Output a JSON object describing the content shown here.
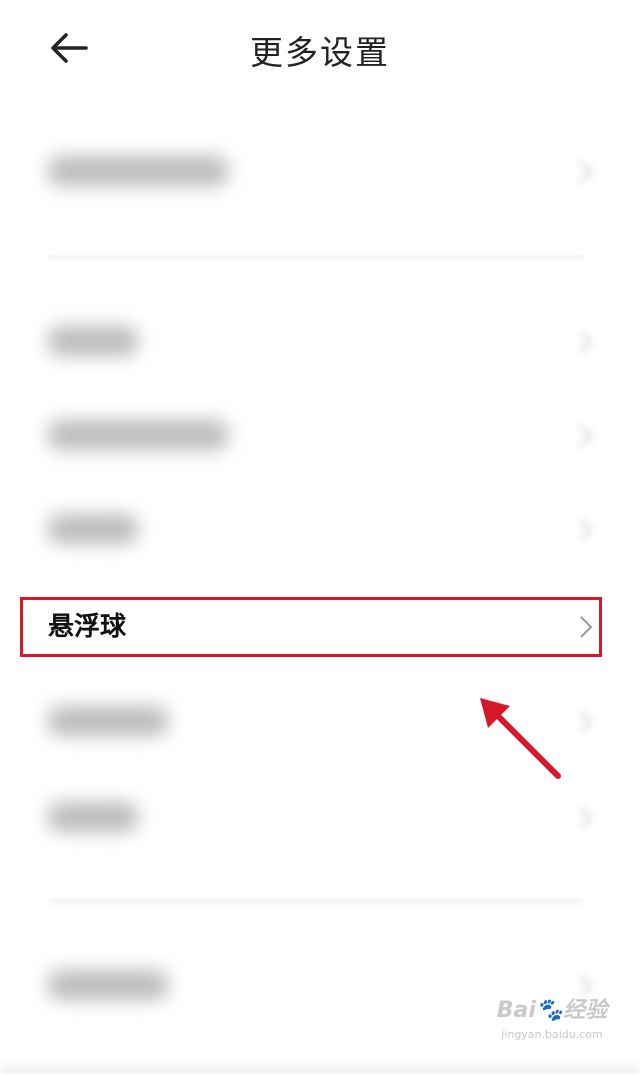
{
  "header": {
    "title": "更多设置",
    "back_icon": "arrow-left-icon"
  },
  "settings": {
    "highlighted_item": {
      "label": "悬浮球",
      "chevron_icon": "chevron-right-icon"
    },
    "obscured_items_count": 7
  },
  "annotation": {
    "highlight_color": "#d6182a",
    "arrow_color": "#d6182a"
  },
  "watermark": {
    "brand": "Bai🐾经验",
    "url": "jingyan.baidu.com"
  }
}
